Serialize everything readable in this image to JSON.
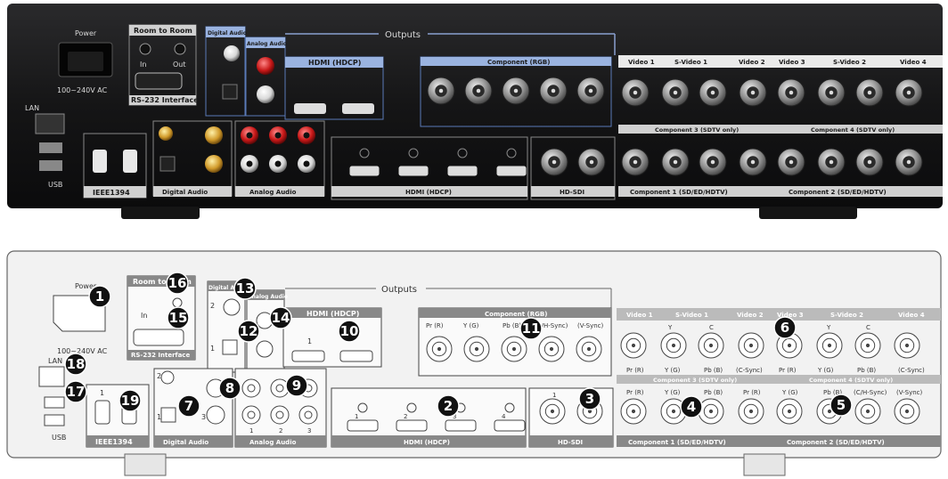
{
  "panel_labels": {
    "power": "Power",
    "room_to_room": "Room to Room",
    "in": "In",
    "out": "Out",
    "voltage": "100~240V AC",
    "rs232": "RS-232 Interface",
    "lan": "LAN",
    "usb": "USB",
    "ieee1394": "IEEE1394",
    "ieee_1": "1",
    "ieee_2": "2",
    "digital_audio": "Digital Audio",
    "analog_audio": "Analog Audio",
    "outputs": "Outputs",
    "hdmi_hdcp": "HDMI (HDCP)",
    "component_rgb": "Component (RGB)",
    "hd_sdi": "HD-SDI",
    "video_1": "Video 1",
    "s_video_1": "S-Video 1",
    "video_2": "Video 2",
    "video_3": "Video 3",
    "s_video_2": "S-Video 2",
    "video_4": "Video 4",
    "component_3": "Component 3 (SDTV only)",
    "component_4": "Component 4 (SDTV only)",
    "component_1": "Component 1 (SD/ED/HDTV)",
    "component_2": "Component 2 (SD/ED/HDTV)",
    "pr_r": "Pr (R)",
    "y_g": "Y (G)",
    "pb_b": "Pb (B)",
    "c_hsync": "(C/H-Sync)",
    "v_sync": "(V-Sync)",
    "c_sync": "(C-Sync)",
    "y": "Y",
    "c": "C",
    "n1": "1",
    "n2": "2",
    "n3": "3",
    "n4": "4"
  },
  "callouts": [
    "1",
    "2",
    "3",
    "4",
    "5",
    "6",
    "7",
    "8",
    "9",
    "10",
    "11",
    "12",
    "13",
    "14",
    "15",
    "16",
    "17",
    "18",
    "19"
  ]
}
